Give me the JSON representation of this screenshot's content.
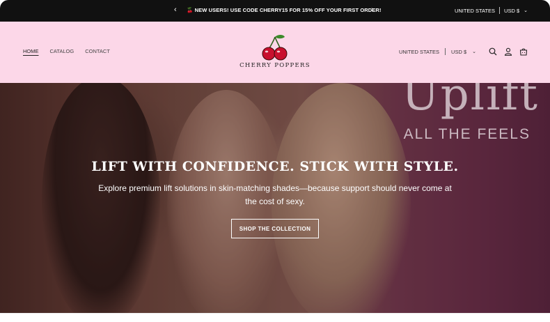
{
  "announcement": {
    "message": "🍒 NEW USERS! USE CODE CHERRY15 FOR 15% OFF YOUR FIRST ORDER!",
    "prev_icon": "chevron-left-icon",
    "next_icon": "chevron-right-icon",
    "country": "UNITED STATES",
    "currency": "USD $"
  },
  "header": {
    "nav": [
      {
        "label": "HOME",
        "active": true
      },
      {
        "label": "CATALOG",
        "active": false
      },
      {
        "label": "CONTACT",
        "active": false
      }
    ],
    "brand": "CHERRY POPPERS",
    "logo_icon": "cherry-icon",
    "country": "UNITED STATES",
    "currency": "USD $",
    "icons": [
      "search-icon",
      "account-icon",
      "cart-icon"
    ]
  },
  "hero": {
    "background_text": "Uplift",
    "background_subtext": "ALL THE FEELS",
    "headline": "LIFT WITH CONFIDENCE. STICK WITH STYLE.",
    "subheadline": "Explore premium lift solutions in skin-matching shades—because support should never come at the cost of sexy.",
    "cta": "SHOP THE COLLECTION"
  },
  "colors": {
    "announcement_bg": "#111111",
    "header_bg": "#fcd7e8",
    "accent": "#c8102e"
  }
}
